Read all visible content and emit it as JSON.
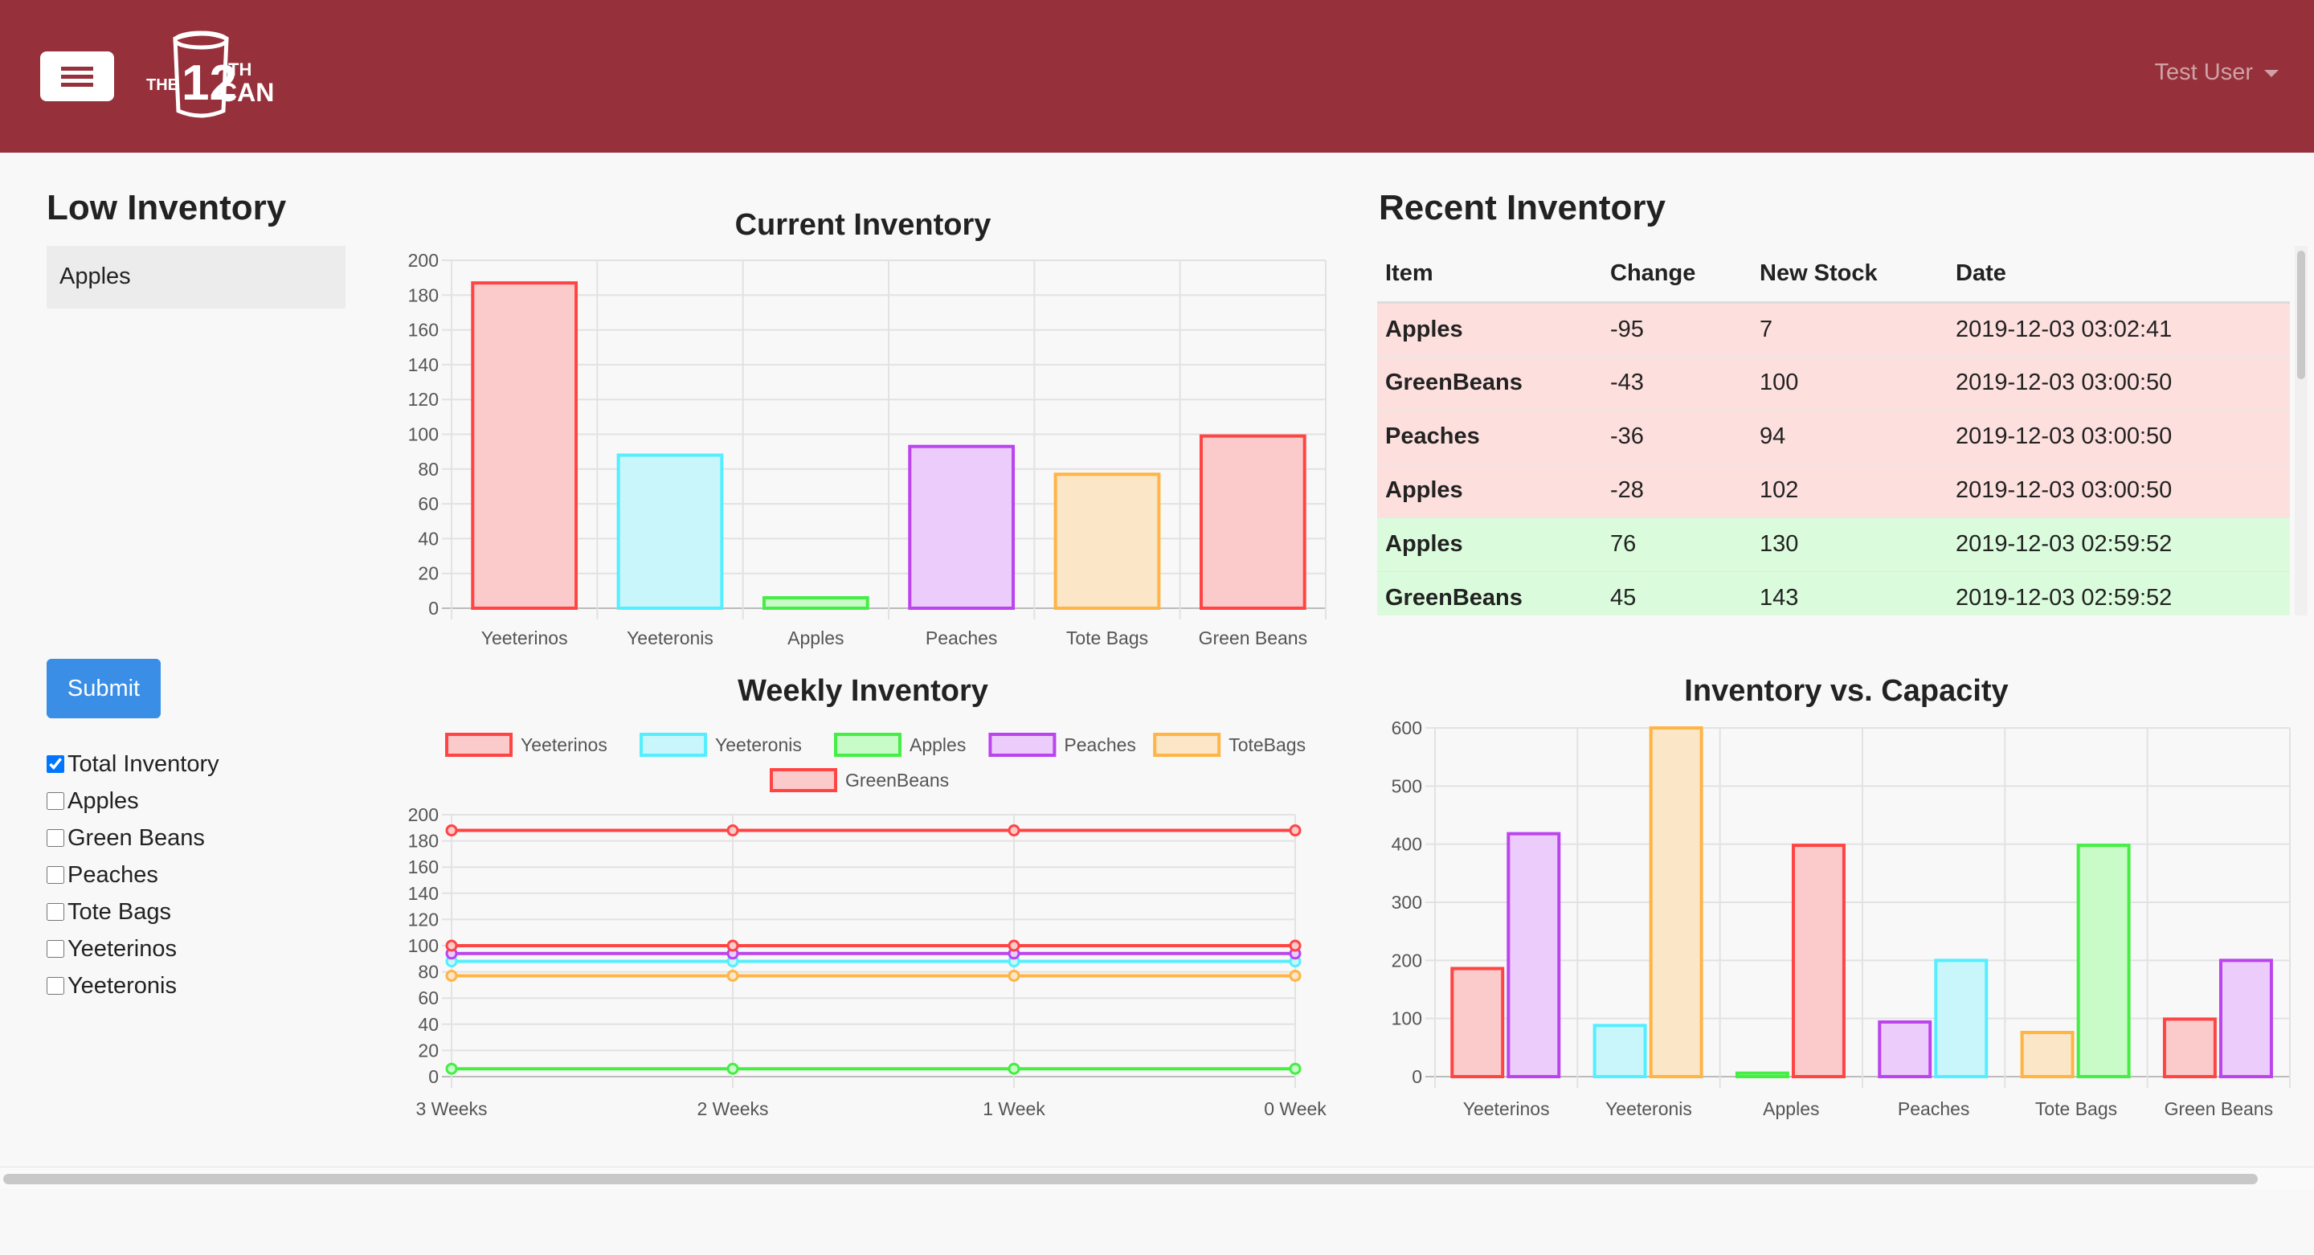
{
  "header": {
    "user_name": "Test User",
    "logo_top": "12",
    "logo_th": "TH",
    "logo_the": "THE",
    "logo_can": "CAN"
  },
  "low_inventory": {
    "title": "Low Inventory",
    "items": [
      "Apples"
    ]
  },
  "submit_label": "Submit",
  "checkboxes": [
    {
      "label": "Total Inventory",
      "checked": true
    },
    {
      "label": "Apples",
      "checked": false
    },
    {
      "label": "Green Beans",
      "checked": false
    },
    {
      "label": "Peaches",
      "checked": false
    },
    {
      "label": "Tote Bags",
      "checked": false
    },
    {
      "label": "Yeeterinos",
      "checked": false
    },
    {
      "label": "Yeeteronis",
      "checked": false
    }
  ],
  "recent_inventory": {
    "title": "Recent Inventory",
    "columns": [
      "Item",
      "Change",
      "New Stock",
      "Date"
    ],
    "rows": [
      {
        "item": "Apples",
        "change": "-95",
        "new_stock": "7",
        "date": "2019-12-03 03:02:41",
        "status": "neg"
      },
      {
        "item": "GreenBeans",
        "change": "-43",
        "new_stock": "100",
        "date": "2019-12-03 03:00:50",
        "status": "neg"
      },
      {
        "item": "Peaches",
        "change": "-36",
        "new_stock": "94",
        "date": "2019-12-03 03:00:50",
        "status": "neg"
      },
      {
        "item": "Apples",
        "change": "-28",
        "new_stock": "102",
        "date": "2019-12-03 03:00:50",
        "status": "neg"
      },
      {
        "item": "Apples",
        "change": "76",
        "new_stock": "130",
        "date": "2019-12-03 02:59:52",
        "status": "pos"
      },
      {
        "item": "GreenBeans",
        "change": "45",
        "new_stock": "143",
        "date": "2019-12-03 02:59:52",
        "status": "pos"
      }
    ]
  },
  "colors": {
    "red": "#ff4444",
    "red_fill": "#fbcaca",
    "cyan": "#55eeff",
    "cyan_fill": "#c8f6fb",
    "green": "#44ee44",
    "green_fill": "#c8fbc8",
    "purple": "#bb44ee",
    "purple_fill": "#ecccfb",
    "orange": "#ffb444",
    "orange_fill": "#fbe6c8",
    "header_bg": "#96303a"
  },
  "chart_data": [
    {
      "id": "current",
      "type": "bar",
      "title": "Current Inventory",
      "categories": [
        "Yeeterinos",
        "Yeeteronis",
        "Apples",
        "Peaches",
        "Tote Bags",
        "Green Beans"
      ],
      "values": [
        187,
        88,
        6,
        93,
        77,
        99
      ],
      "colors": [
        "red",
        "cyan",
        "green",
        "purple",
        "orange",
        "red"
      ],
      "ylim": [
        0,
        200
      ],
      "yticks": [
        0,
        20,
        40,
        60,
        80,
        100,
        120,
        140,
        160,
        180,
        200
      ],
      "grid": true
    },
    {
      "id": "weekly",
      "type": "line",
      "title": "Weekly Inventory",
      "x": [
        "3 Weeks",
        "2 Weeks",
        "1 Week",
        "0 Week"
      ],
      "series": [
        {
          "name": "Yeeterinos",
          "color": "red",
          "values": [
            188,
            188,
            188,
            188
          ]
        },
        {
          "name": "Yeeteronis",
          "color": "cyan",
          "values": [
            88,
            88,
            88,
            88
          ]
        },
        {
          "name": "Apples",
          "color": "green",
          "values": [
            6,
            6,
            6,
            6
          ]
        },
        {
          "name": "Peaches",
          "color": "purple",
          "values": [
            94,
            94,
            94,
            94
          ]
        },
        {
          "name": "ToteBags",
          "color": "orange",
          "values": [
            77,
            77,
            77,
            77
          ]
        },
        {
          "name": "GreenBeans",
          "color": "red",
          "values": [
            100,
            100,
            100,
            100
          ]
        }
      ],
      "ylim": [
        0,
        200
      ],
      "yticks": [
        0,
        20,
        40,
        60,
        80,
        100,
        120,
        140,
        160,
        180,
        200
      ],
      "legend": "top",
      "grid": true
    },
    {
      "id": "capacity",
      "type": "bar",
      "title": "Inventory vs. Capacity",
      "categories": [
        "Yeeterinos",
        "Yeeteronis",
        "Apples",
        "Peaches",
        "Tote Bags",
        "Green Beans"
      ],
      "series": [
        {
          "values": [
            186,
            88,
            6,
            94,
            76,
            99
          ],
          "colors": [
            "red",
            "cyan",
            "green",
            "purple",
            "orange",
            "red"
          ]
        },
        {
          "values": [
            418,
            600,
            398,
            200,
            398,
            200
          ],
          "colors": [
            "purple",
            "orange",
            "red",
            "cyan",
            "green",
            "purple"
          ]
        }
      ],
      "ylim": [
        0,
        600
      ],
      "yticks": [
        0,
        100,
        200,
        300,
        400,
        500,
        600
      ],
      "grid": true
    }
  ]
}
